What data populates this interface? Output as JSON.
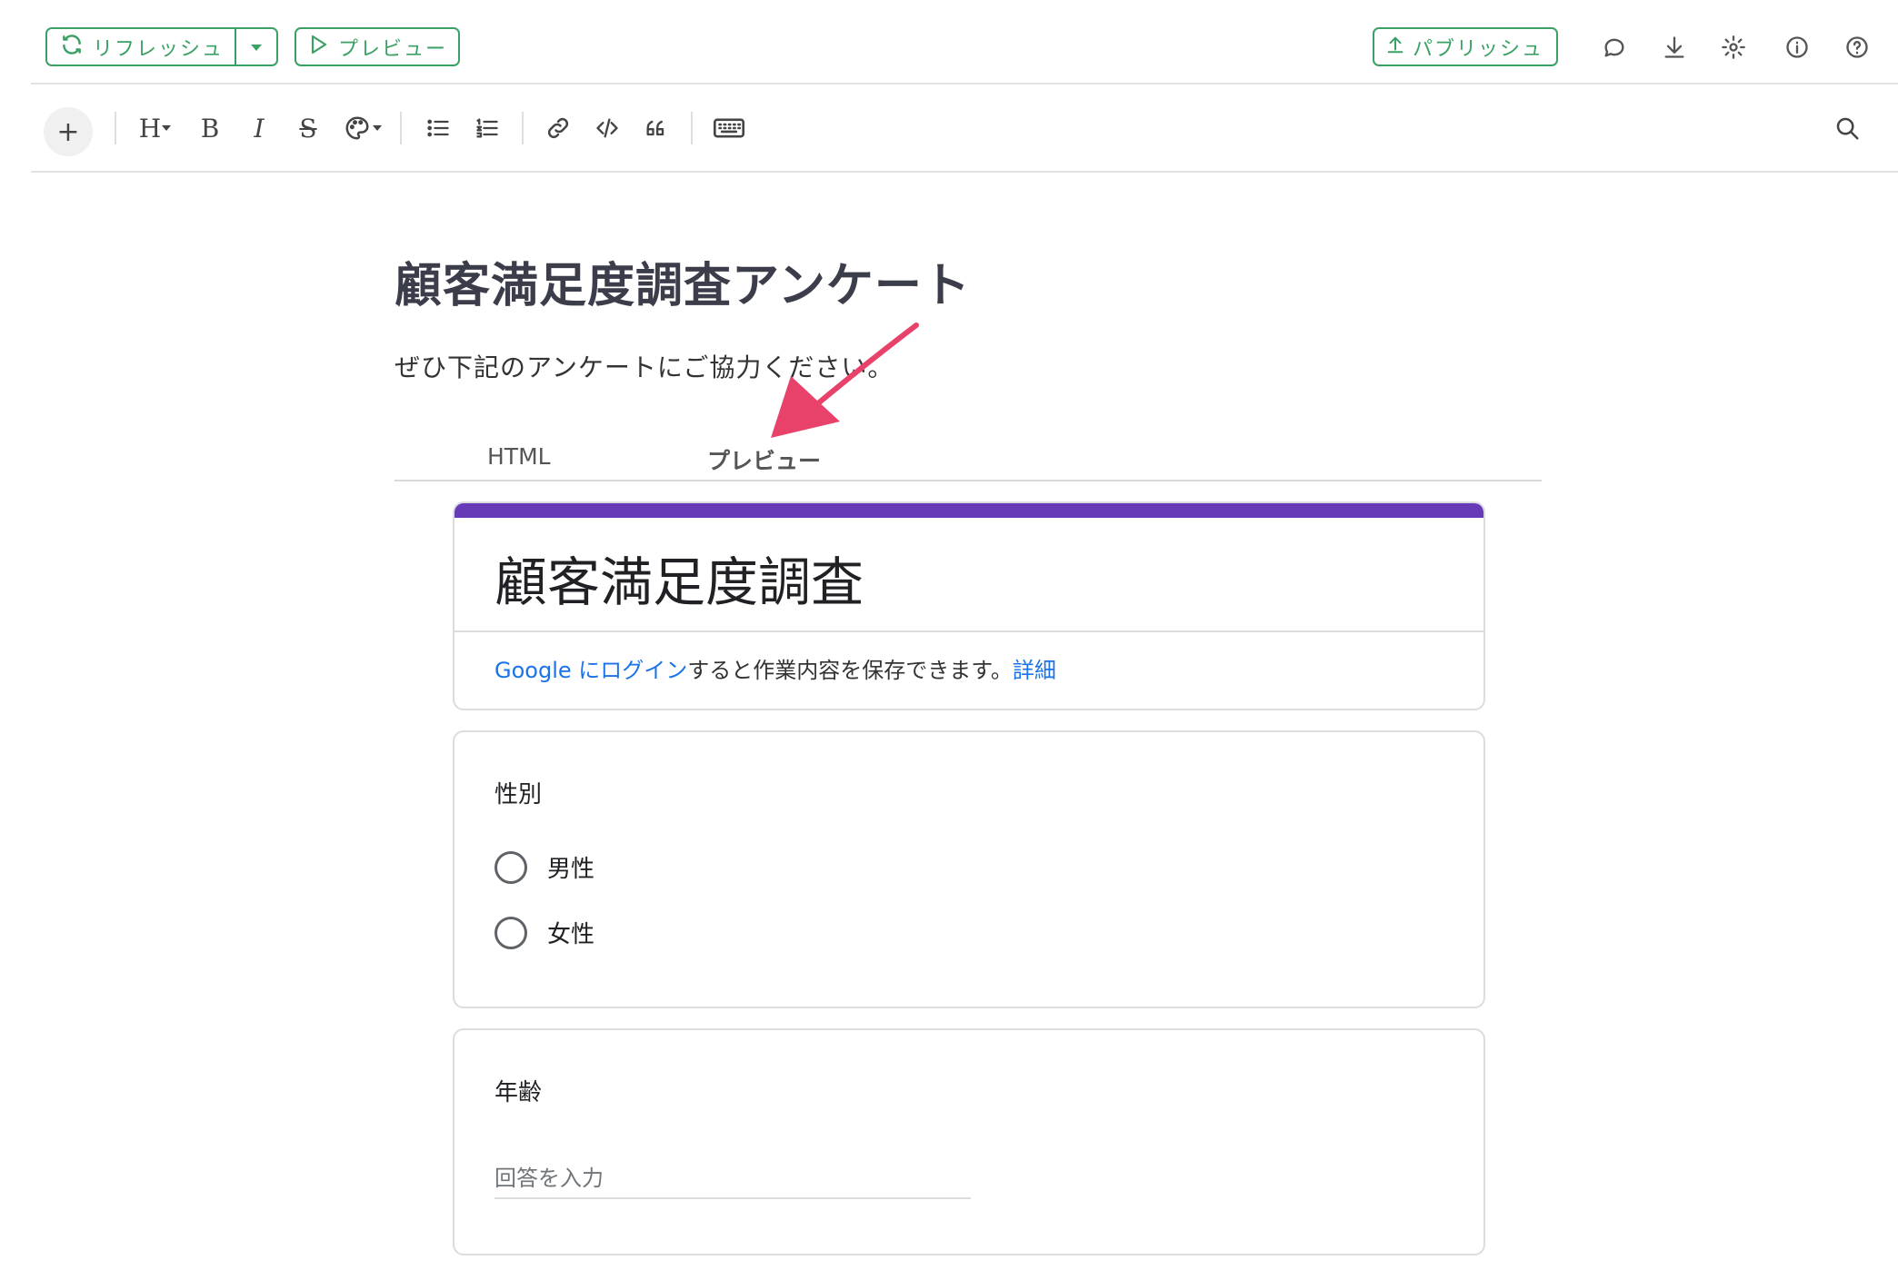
{
  "toolbar_top": {
    "refresh_label": "リフレッシュ",
    "preview_label": "プレビュー",
    "publish_label": "パブリッシュ",
    "icons": [
      "comment-icon",
      "download-icon",
      "gear-icon",
      "info-icon",
      "help-icon"
    ]
  },
  "editor_toolbar": {
    "add_label": "+",
    "heading_label": "H",
    "bold_label": "B",
    "italic_label": "I",
    "strike_label": "S"
  },
  "document": {
    "title": "顧客満足度調査アンケート",
    "subtitle": "ぜひ下記のアンケートにご協力ください。"
  },
  "tabs": [
    {
      "label": "HTML",
      "active": false
    },
    {
      "label": "プレビュー",
      "active": true
    }
  ],
  "form": {
    "accent_color": "#673ab7",
    "title": "顧客満足度調査",
    "login_link": "Google にログイン",
    "login_text": "すると作業内容を保存できます。",
    "details_link": "詳細",
    "questions": [
      {
        "title": "性別",
        "options": [
          "男性",
          "女性"
        ]
      },
      {
        "title": "年齢",
        "placeholder": "回答を入力"
      }
    ]
  },
  "colors": {
    "brand_green": "#3aa063",
    "annotation_arrow": "#e8426b"
  }
}
